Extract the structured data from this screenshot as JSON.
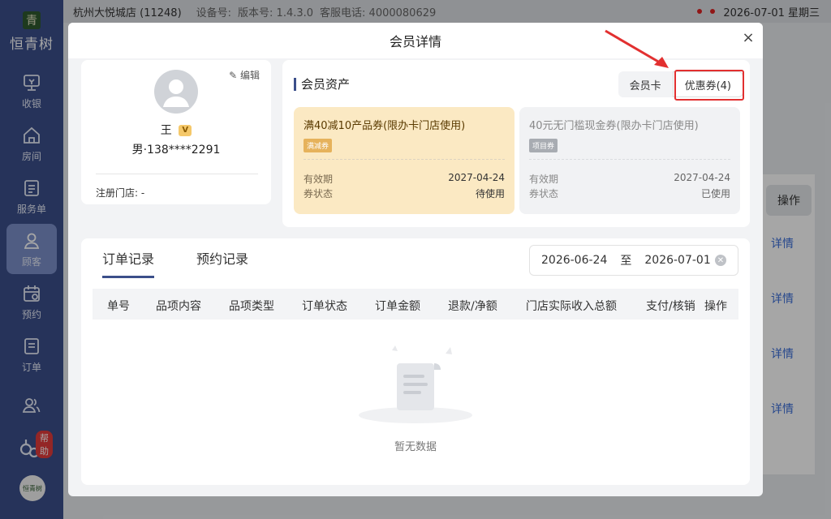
{
  "sidebar": {
    "brand_mark": "青",
    "brand_name": "恒青树",
    "items": [
      {
        "label": "收银",
        "icon": "cashier-icon"
      },
      {
        "label": "房间",
        "icon": "home-icon"
      },
      {
        "label": "服务单",
        "icon": "service-order-icon"
      },
      {
        "label": "顾客",
        "icon": "customer-icon",
        "active": true
      },
      {
        "label": "预约",
        "icon": "calendar-icon"
      },
      {
        "label": "订单",
        "icon": "order-icon"
      },
      {
        "label": "",
        "icon": "staff-icon"
      }
    ],
    "help_badge": "帮助",
    "bottom_logo": "恒青树"
  },
  "topbar": {
    "store": "杭州大悦城店",
    "store_id": "(11248)",
    "device_label": "设备号:",
    "version": "版本号: 1.4.3.0",
    "service_phone": "客服电话: 4000080629",
    "datetime": "2026-07-01 星期三"
  },
  "background": {
    "op_header": "操作",
    "detail_link": "详情"
  },
  "modal": {
    "title": "会员详情",
    "close": "×",
    "profile": {
      "edit_label": "编辑",
      "name": "王",
      "vip_badge": "V",
      "info": "男·138****2291",
      "reg_store": "注册门店: -"
    },
    "assets": {
      "title": "会员资产",
      "tab_card": "会员卡",
      "tab_coupons": "优惠券(4)",
      "coupons": [
        {
          "title": "满40减10产品券(限办卡门店使用)",
          "tag": "满减券",
          "validity_label": "有效期",
          "validity": "2027-04-24",
          "status_label": "券状态",
          "status": "待使用"
        },
        {
          "title": "40元无门槛现金券(限办卡门店使用)",
          "tag": "项目券",
          "validity_label": "有效期",
          "validity": "2027-04-24",
          "status_label": "券状态",
          "status": "已使用"
        }
      ]
    },
    "orders": {
      "tab_orders": "订单记录",
      "tab_appointments": "预约记录",
      "date_from": "2026-06-24",
      "date_sep": "至",
      "date_to": "2026-07-01",
      "columns": [
        "单号",
        "品项内容",
        "品项类型",
        "订单状态",
        "订单金额",
        "退款/净额",
        "门店实际收入总额",
        "支付/核销",
        "操作"
      ],
      "empty_text": "暂无数据"
    }
  },
  "colors": {
    "sidebar": "#3b4f8a",
    "highlight": "#e23030",
    "coupon_active": "#fbe9c3"
  }
}
